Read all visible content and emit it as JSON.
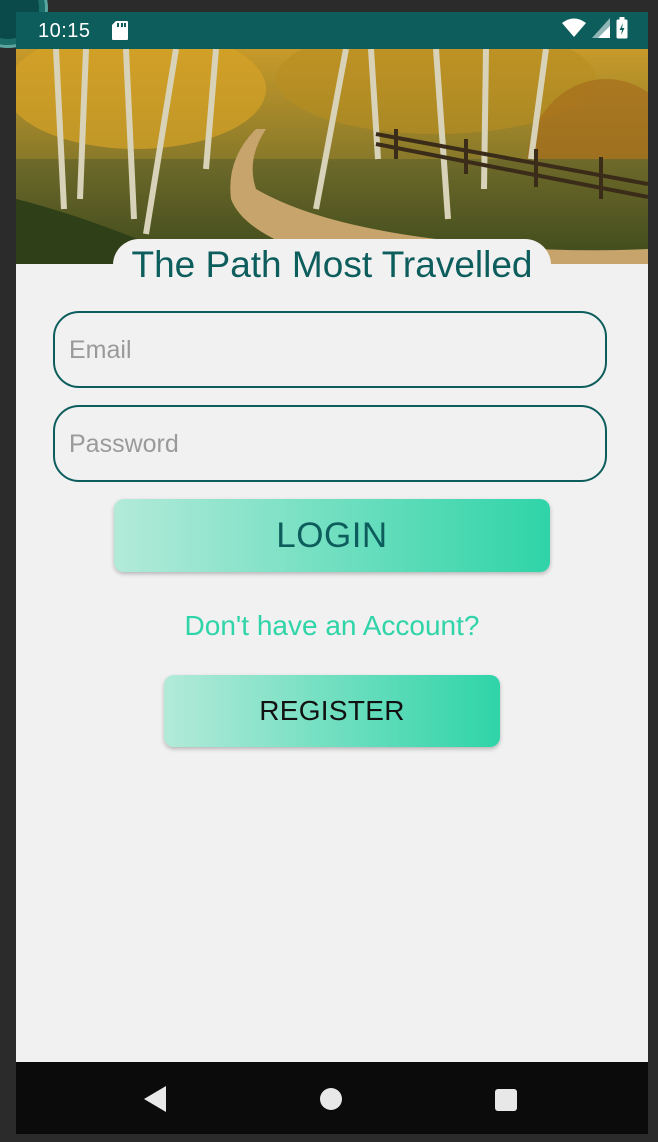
{
  "status_bar": {
    "time": "10:15"
  },
  "header": {
    "title": "The Path Most Travelled"
  },
  "form": {
    "email_placeholder": "Email",
    "password_placeholder": "Password",
    "login_label": "LOGIN",
    "no_account_text": "Don't have an Account?",
    "register_label": "REGISTER"
  },
  "colors": {
    "primary_teal": "#0d5d5d",
    "accent_green": "#2fd4a8",
    "button_gradient_start": "#b3ead9",
    "background": "#f1f1f1"
  },
  "icons": {
    "status": [
      "sd-card-icon",
      "wifi-icon",
      "cell-signal-icon",
      "battery-icon"
    ],
    "navigation": [
      "back-icon",
      "home-icon",
      "recent-apps-icon"
    ]
  }
}
